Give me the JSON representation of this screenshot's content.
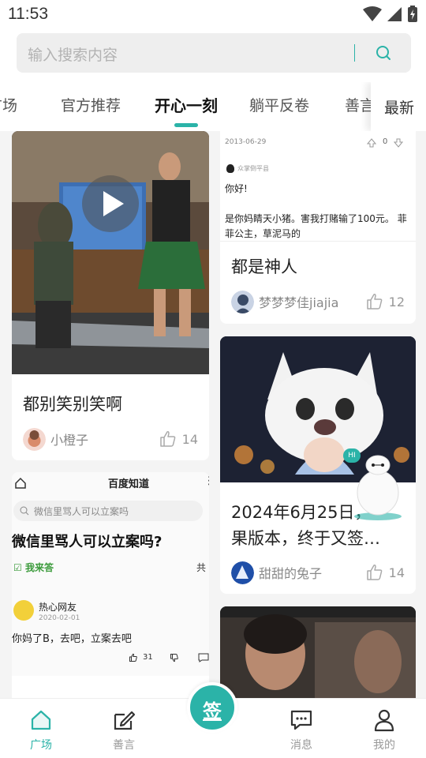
{
  "status": {
    "time": "11:53"
  },
  "search": {
    "placeholder": "输入搜索内容"
  },
  "tabs": [
    {
      "label": "广场"
    },
    {
      "label": "官方推荐"
    },
    {
      "label": "开心一刻"
    },
    {
      "label": "躺平反卷"
    },
    {
      "label": "善言"
    }
  ],
  "latest": "最新",
  "cards": [
    {
      "title": "都别笑别笑啊",
      "author": "小橙子",
      "likes": "14"
    },
    {
      "title": "都是神人",
      "author": "梦梦梦佳jiajia",
      "likes": "12"
    },
    {
      "title_line1": "2024年6月25日，",
      "title_line2": "果版本，终于又签…",
      "author": "甜甜的兔子",
      "likes": "14"
    }
  ],
  "screenshot_post": {
    "date": "2013-06-29",
    "score": "0",
    "user": "众掌倒平县",
    "greeting": "你好!",
    "body": "是你妈睛天小猪。害我打赌输了100元。 菲菲公主，草泥马的"
  },
  "baidu_post": {
    "app": "百度知道",
    "search_text": "微信里骂人可以立案吗",
    "question": "微信里骂人可以立案吗?",
    "answer_button": "我来答",
    "share": "共",
    "answerer": "热心网友",
    "answer_date": "2020-02-01",
    "answer": "你妈了B，去吧，立案去吧",
    "likes": "31"
  },
  "bottom_nav": {
    "square": "广场",
    "good_words": "善言",
    "sign": "签",
    "messages": "消息",
    "mine": "我的"
  },
  "colors": {
    "accent": "#2bb3a8"
  }
}
